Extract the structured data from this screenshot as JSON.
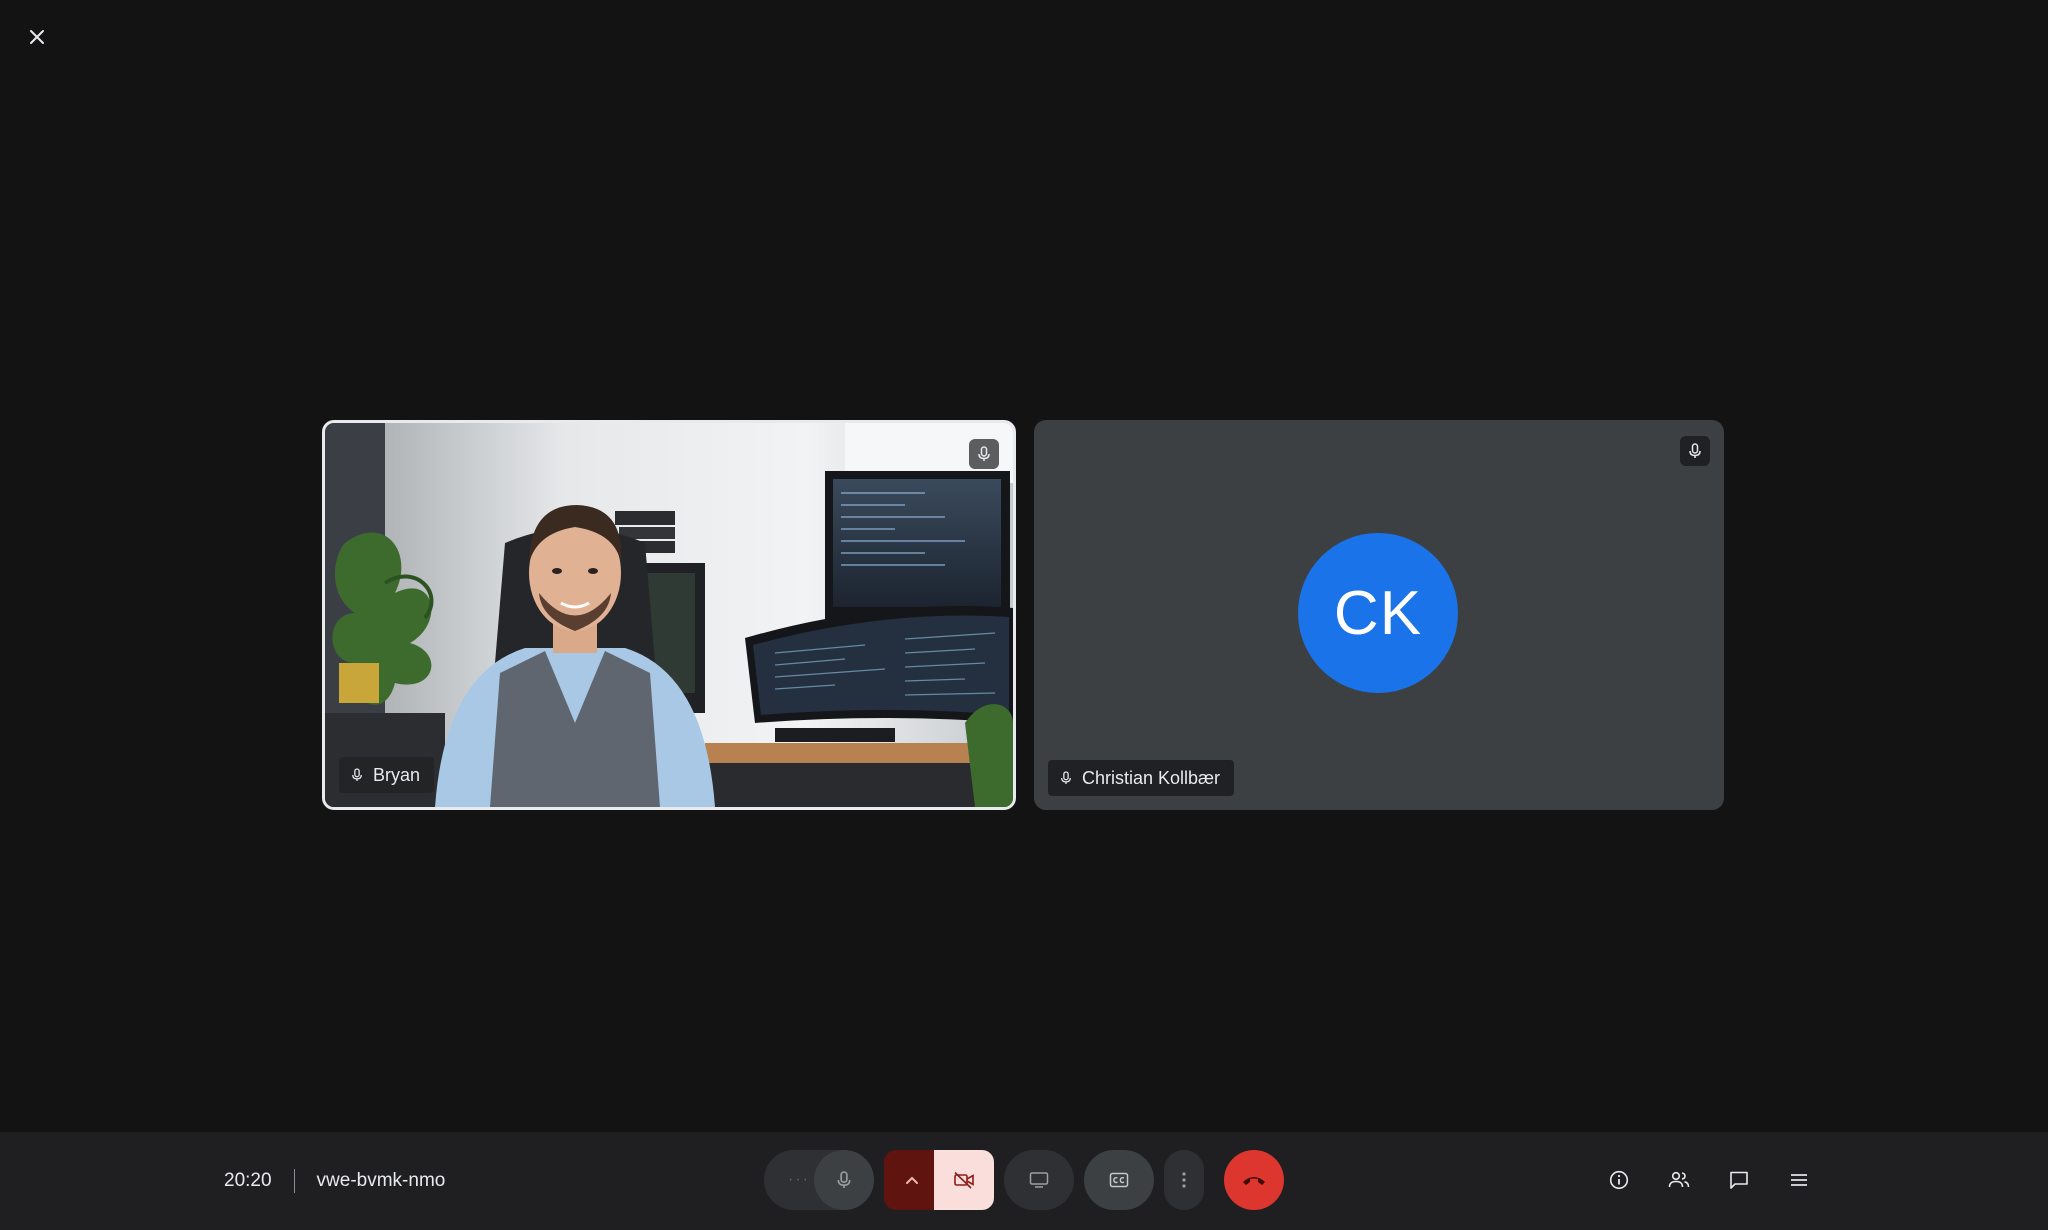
{
  "window": {
    "close_icon": "close-icon"
  },
  "participants": [
    {
      "name": "Bryan",
      "mic_icon": "mic-icon"
    },
    {
      "name": "Christian Kollbær",
      "initials": "CK",
      "avatar_color": "#1a73e8",
      "mic_icon": "mic-icon"
    }
  ],
  "meeting": {
    "time": "20:20",
    "code": "vwe-bvmk-nmo"
  },
  "controls": {
    "more_options_icon": "more-horizontal-icon",
    "mic_icon": "mic-icon",
    "camera_options_icon": "chevron-up-icon",
    "camera_icon": "videocam-off-icon",
    "present_icon": "present-screen-icon",
    "captions_icon": "closed-captions-icon",
    "more_icon": "more-vertical-icon",
    "hangup_icon": "call-end-icon",
    "hangup_color": "#dc362e",
    "camera_off_bg": "#f9dedc"
  },
  "side_panel_icons": [
    "info-icon",
    "people-icon",
    "chat-icon",
    "activities-icon"
  ]
}
